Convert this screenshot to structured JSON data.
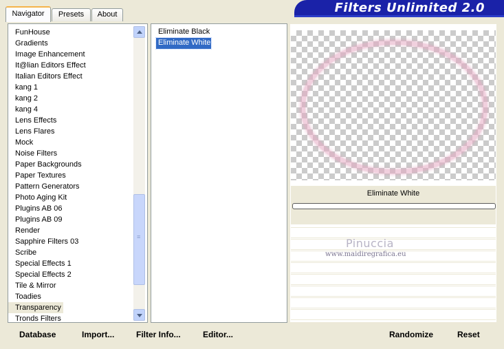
{
  "tabs": [
    {
      "label": "Navigator",
      "active": true
    },
    {
      "label": "Presets",
      "active": false
    },
    {
      "label": "About",
      "active": false
    }
  ],
  "banner": {
    "title": "Filters Unlimited 2.0"
  },
  "categories": [
    "FunHouse",
    "Gradients",
    "Image Enhancement",
    "It@lian Editors Effect",
    "Italian Editors Effect",
    "kang 1",
    "kang 2",
    "kang 4",
    "Lens Effects",
    "Lens Flares",
    "Mock",
    "Noise Filters",
    "Paper Backgrounds",
    "Paper Textures",
    "Pattern Generators",
    "Photo Aging Kit",
    "Plugins AB 06",
    "Plugins AB 09",
    "Render",
    "Sapphire Filters 03",
    "Scribe",
    "Special Effects 1",
    "Special Effects 2",
    "Tile & Mirror",
    "Toadies",
    "Transparency",
    "Tronds Filters"
  ],
  "selected_category_index": 25,
  "filters": [
    "Eliminate Black",
    "Eliminate White"
  ],
  "selected_filter_index": 1,
  "preview": {
    "filter_name": "Eliminate White"
  },
  "watermark": {
    "name": "Pinuccia",
    "url": "www.maidiregrafica.eu"
  },
  "buttons": {
    "database": "Database",
    "import": "Import...",
    "filter_info": "Filter Info...",
    "editor": "Editor...",
    "randomize": "Randomize",
    "reset": "Reset"
  },
  "colors": {
    "banner": "#1a22a8",
    "selection": "#316ac5",
    "background": "#ece9d8"
  }
}
